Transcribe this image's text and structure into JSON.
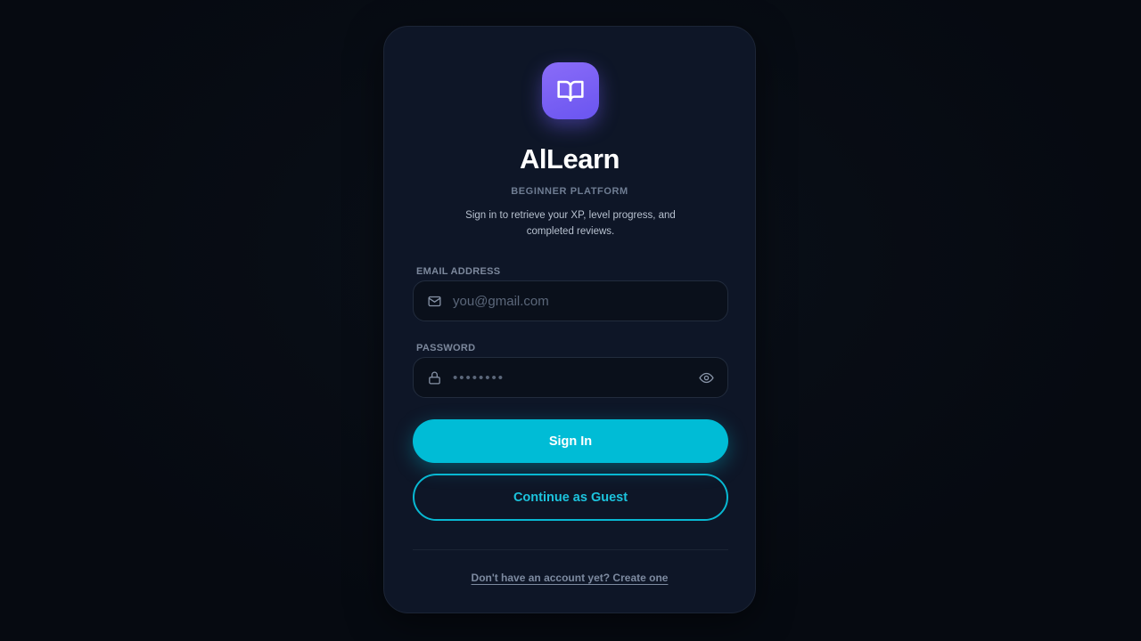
{
  "app": {
    "title": "AlLearn",
    "subtitle": "BEGINNER PLATFORM",
    "description": "Sign in to retrieve your XP, level progress, and completed reviews.",
    "logo_icon": "book-open-icon"
  },
  "form": {
    "email": {
      "label": "EMAIL ADDRESS",
      "placeholder": "you@gmail.com",
      "value": "",
      "icon": "mail-icon"
    },
    "password": {
      "label": "PASSWORD",
      "placeholder": "••••••••",
      "value": "",
      "icon": "lock-icon",
      "toggle_icon": "eye-icon"
    },
    "sign_in_label": "Sign In",
    "guest_label": "Continue as Guest"
  },
  "footer": {
    "create_account_link": "Don't have an account yet? Create one"
  },
  "colors": {
    "accent": "#00bcd6",
    "logo": "#7b62f6",
    "card_bg": "#0e1627",
    "page_bg": "#060a12"
  }
}
